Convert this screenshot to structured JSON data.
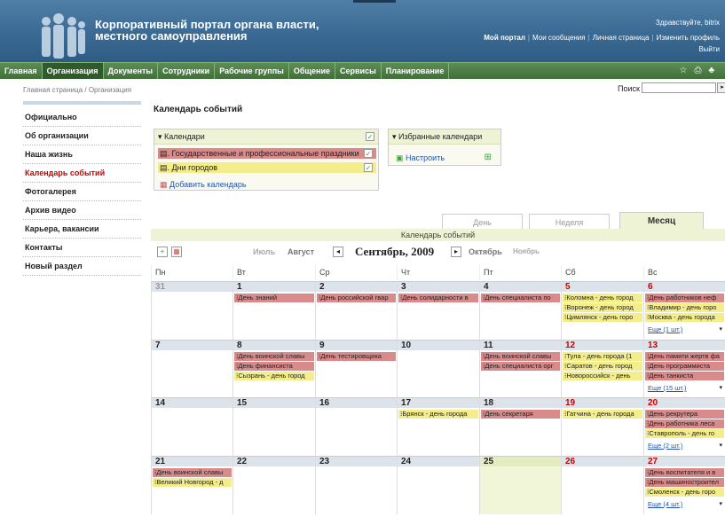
{
  "header": {
    "title_line1": "Корпоративный портал органа власти,",
    "title_line2": "местного самоуправления",
    "greeting": "Здравствуйте, bitrix",
    "links": [
      "Мой портал",
      "Мои сообщения",
      "Личная страница",
      "Изменить профиль"
    ],
    "exit": "Выйти"
  },
  "nav": {
    "items": [
      "Главная",
      "Организация",
      "Документы",
      "Сотрудники",
      "Рабочие группы",
      "Общение",
      "Сервисы",
      "Планирование"
    ],
    "active": "Организация"
  },
  "breadcrumb": "Главная страница / Организация",
  "search": {
    "label": "Поиск",
    "value": ""
  },
  "sidebar": {
    "items": [
      "Официально",
      "Об организации",
      "Наша жизнь",
      "Календарь событий",
      "Фотогалерея",
      "Архив видео",
      "Карьера, вакансии",
      "Контакты",
      "Новый раздел"
    ],
    "active": "Календарь событий"
  },
  "page_title": "Календарь событий",
  "calendars": {
    "header": "▾ Календари",
    "items": [
      {
        "label": "Государственные и профессиональные праздники",
        "color": "#d98a8a"
      },
      {
        "label": "Дни городов",
        "color": "#f3ed8c"
      }
    ],
    "add": "Добавить календарь"
  },
  "favorites": {
    "header": "▾ Избранные календари",
    "setup": "Настроить"
  },
  "tabs": [
    "День",
    "Неделя",
    "Месяц"
  ],
  "active_tab": "Месяц",
  "calendar_header": "Календарь событий",
  "month_nav": {
    "prev2": "Июль",
    "prev1": "Август",
    "current": "Сентябрь, 2009",
    "next1": "Октябрь",
    "next2": "Ноябрь"
  },
  "weekdays": [
    "Пн",
    "Вт",
    "Ср",
    "Чт",
    "Пт",
    "Сб",
    "Вс"
  ],
  "weeks": [
    [
      {
        "d": "31",
        "muted": true,
        "events": []
      },
      {
        "d": "1",
        "events": [
          {
            "t": "День знаний",
            "c": "red"
          }
        ]
      },
      {
        "d": "2",
        "events": [
          {
            "t": "День российской гвар",
            "c": "red"
          }
        ]
      },
      {
        "d": "3",
        "events": [
          {
            "t": "День солидарности в",
            "c": "red"
          }
        ]
      },
      {
        "d": "4",
        "events": [
          {
            "t": "День специалиста по",
            "c": "red"
          }
        ]
      },
      {
        "d": "5",
        "weekend": true,
        "events": [
          {
            "t": "Коломна - день город",
            "c": "yel"
          },
          {
            "t": "Воронеж - день город",
            "c": "yel"
          },
          {
            "t": "Цимлянск - день горо",
            "c": "yel"
          }
        ]
      },
      {
        "d": "6",
        "weekend": true,
        "events": [
          {
            "t": "День работников неф",
            "c": "red"
          },
          {
            "t": "Владимир - день горо",
            "c": "yel"
          },
          {
            "t": "Москва - день города",
            "c": "yel"
          }
        ],
        "more": "Еще (1 шт.)"
      }
    ],
    [
      {
        "d": "7",
        "events": []
      },
      {
        "d": "8",
        "events": [
          {
            "t": "День воинской славы",
            "c": "red"
          },
          {
            "t": "День финансиста",
            "c": "red"
          },
          {
            "t": "Сызрань - день город",
            "c": "yel"
          }
        ]
      },
      {
        "d": "9",
        "events": [
          {
            "t": "День тестировщика",
            "c": "red"
          }
        ]
      },
      {
        "d": "10",
        "events": []
      },
      {
        "d": "11",
        "events": [
          {
            "t": "День воинской славы",
            "c": "red"
          },
          {
            "t": "День специалиста орг",
            "c": "red"
          }
        ]
      },
      {
        "d": "12",
        "weekend": true,
        "events": [
          {
            "t": "Тула - день города (1",
            "c": "yel"
          },
          {
            "t": "Саратов - день город",
            "c": "yel"
          },
          {
            "t": "Новороссийск - день",
            "c": "yel"
          }
        ]
      },
      {
        "d": "13",
        "weekend": true,
        "events": [
          {
            "t": "День памяти жертв фа",
            "c": "red"
          },
          {
            "t": "День программиста",
            "c": "red"
          },
          {
            "t": "День танкиста",
            "c": "red"
          }
        ],
        "more": "Еще (15 шт.)"
      }
    ],
    [
      {
        "d": "14",
        "events": []
      },
      {
        "d": "15",
        "events": []
      },
      {
        "d": "16",
        "events": []
      },
      {
        "d": "17",
        "events": [
          {
            "t": "Брянск - день города",
            "c": "yel"
          }
        ]
      },
      {
        "d": "18",
        "events": [
          {
            "t": "День секретаря",
            "c": "red"
          }
        ]
      },
      {
        "d": "19",
        "weekend": true,
        "events": [
          {
            "t": "Гатчина - день города",
            "c": "yel"
          }
        ]
      },
      {
        "d": "20",
        "weekend": true,
        "events": [
          {
            "t": "День рекрутера",
            "c": "red"
          },
          {
            "t": "День работника леса",
            "c": "red"
          },
          {
            "t": "Ставрополь - день го",
            "c": "yel"
          }
        ],
        "more": "Еще (2 шт.)"
      }
    ],
    [
      {
        "d": "21",
        "events": [
          {
            "t": "День воинской славы",
            "c": "red"
          },
          {
            "t": "Великий Новгород - д",
            "c": "yel"
          }
        ]
      },
      {
        "d": "22",
        "events": []
      },
      {
        "d": "23",
        "events": []
      },
      {
        "d": "24",
        "events": []
      },
      {
        "d": "25",
        "today": true,
        "events": []
      },
      {
        "d": "26",
        "weekend": true,
        "events": []
      },
      {
        "d": "27",
        "weekend": true,
        "events": [
          {
            "t": "День воспитателя и в",
            "c": "red"
          },
          {
            "t": "День машиностроител",
            "c": "red"
          },
          {
            "t": "Смоленск - день горо",
            "c": "yel"
          }
        ],
        "more": "Еще (4 шт.)"
      }
    ]
  ]
}
